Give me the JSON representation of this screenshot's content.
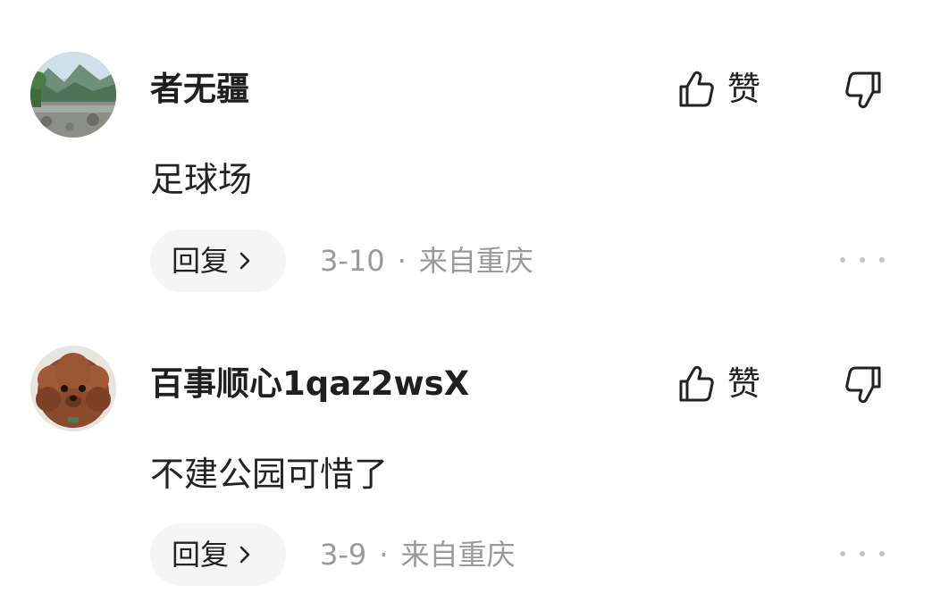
{
  "comments": [
    {
      "username": "者无疆",
      "content": "足球场",
      "like_label": "赞",
      "reply_label": "回复",
      "date": "3-10",
      "separator": "·",
      "location": "来自重庆",
      "avatar_icon": "landscape-avatar",
      "like_icon": "thumbs-up-icon",
      "dislike_icon": "thumbs-down-icon",
      "more_icon": "more-dots-icon"
    },
    {
      "username": "百事顺心1qaz2wsX",
      "content": "不建公园可惜了",
      "like_label": "赞",
      "reply_label": "回复",
      "date": "3-9",
      "separator": "·",
      "location": "来自重庆",
      "avatar_icon": "dog-avatar",
      "like_icon": "thumbs-up-icon",
      "dislike_icon": "thumbs-down-icon",
      "more_icon": "more-dots-icon"
    }
  ],
  "colors": {
    "text": "#222222",
    "meta": "#9a9a9a",
    "reply_bg": "#f5f5f5",
    "dots": "#c4c4c4"
  }
}
